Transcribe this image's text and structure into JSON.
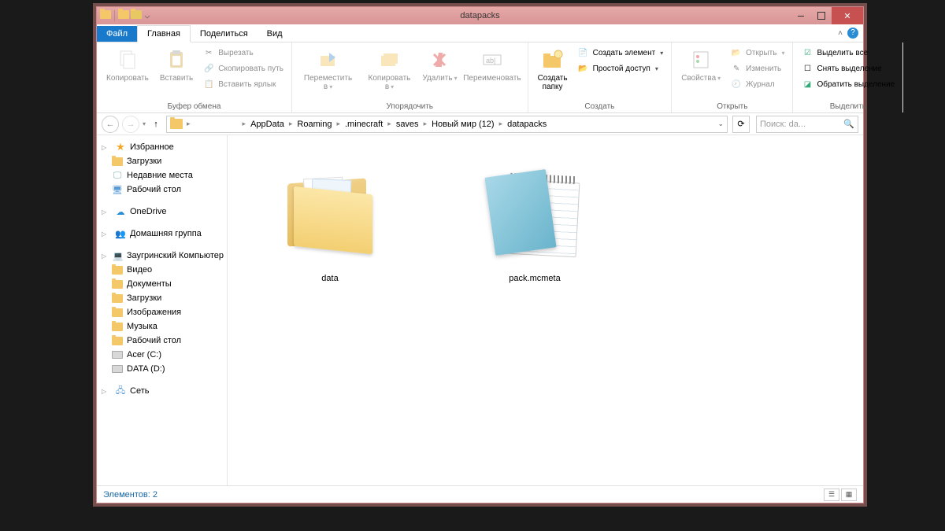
{
  "window": {
    "title": "datapacks"
  },
  "tabs": {
    "file": "Файл",
    "home": "Главная",
    "share": "Поделиться",
    "view": "Вид"
  },
  "ribbon": {
    "clipboard": {
      "copy": "Копировать",
      "paste": "Вставить",
      "cut": "Вырезать",
      "copy_path": "Скопировать путь",
      "paste_shortcut": "Вставить ярлык",
      "group": "Буфер обмена"
    },
    "organize": {
      "move_to": "Переместить в",
      "copy_to": "Копировать в",
      "delete": "Удалить",
      "rename": "Переименовать",
      "group": "Упорядочить"
    },
    "new": {
      "new_folder": "Создать папку",
      "new_item": "Создать элемент",
      "easy_access": "Простой доступ",
      "group": "Создать"
    },
    "open": {
      "properties": "Свойства",
      "open": "Открыть",
      "edit": "Изменить",
      "history": "Журнал",
      "group": "Открыть"
    },
    "select": {
      "select_all": "Выделить все",
      "select_none": "Снять выделение",
      "invert": "Обратить выделение",
      "group": "Выделить"
    }
  },
  "breadcrumbs": [
    "AppData",
    "Roaming",
    ".minecraft",
    "saves",
    "Новый мир (12)",
    "datapacks"
  ],
  "search_placeholder": "Поиск: da...",
  "nav_pane": {
    "favorites": {
      "label": "Избранное",
      "items": [
        "Загрузки",
        "Недавние места",
        "Рабочий стол"
      ]
    },
    "onedrive": "OneDrive",
    "homegroup": "Домашняя группа",
    "computer": {
      "label": "Заугринский Компьютер",
      "items": [
        "Видео",
        "Документы",
        "Загрузки",
        "Изображения",
        "Музыка",
        "Рабочий стол",
        "Acer (C:)",
        "DATA (D:)"
      ]
    },
    "network": "Сеть"
  },
  "files": {
    "folder_name": "data",
    "text_file_name": "pack.mcmeta"
  },
  "status": {
    "items": "Элементов: 2"
  }
}
